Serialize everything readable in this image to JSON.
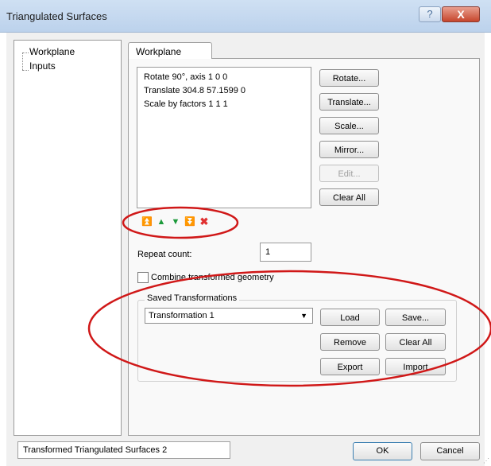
{
  "window": {
    "title": "Triangulated Surfaces",
    "help_glyph": "?",
    "close_glyph": "X"
  },
  "tree": {
    "items": [
      {
        "label": "Workplane"
      },
      {
        "label": "Inputs"
      }
    ]
  },
  "tab": {
    "label": "Workplane"
  },
  "transform_list": {
    "items": [
      "Rotate 90°, axis 1 0 0",
      "Translate 304.8 57.1599 0",
      "Scale by factors 1 1 1"
    ]
  },
  "buttons": {
    "rotate": "Rotate...",
    "translate": "Translate...",
    "scale": "Scale...",
    "mirror": "Mirror...",
    "edit": "Edit...",
    "clear_all": "Clear All"
  },
  "arrow_icons": [
    "move-top-icon",
    "move-up-icon",
    "move-down-icon",
    "move-bottom-icon",
    "delete-icon"
  ],
  "repeat": {
    "label": "Repeat count:",
    "value": "1"
  },
  "combine": {
    "label": "Combine transformed geometry",
    "checked": false
  },
  "saved": {
    "label": "Saved Transformations",
    "selected": "Transformation 1",
    "buttons": {
      "load": "Load",
      "save": "Save...",
      "remove": "Remove",
      "clear_all": "Clear All",
      "export": "Export",
      "import": "Import"
    }
  },
  "footer": {
    "name_value": "Transformed Triangulated Surfaces 2",
    "ok": "OK",
    "cancel": "Cancel"
  },
  "colors": {
    "annotation": "#d01818",
    "arrow_green": "#1c9a3a",
    "delete_red": "#e03030"
  }
}
